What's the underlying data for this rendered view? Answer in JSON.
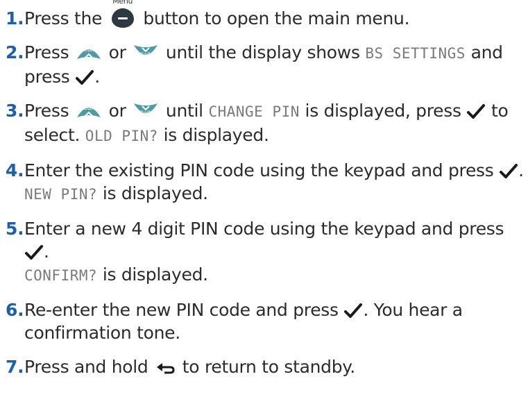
{
  "steps": [
    {
      "number": "1",
      "parts": {
        "a": "Press the",
        "menu_caption": "Menu",
        "b": "button to open the main menu."
      }
    },
    {
      "number": "2",
      "parts": {
        "a": "Press",
        "redial_label": "Redial",
        "or": "or",
        "calls_label": "Calls",
        "b": "until the display shows",
        "lcd": "BS SETTINGS",
        "c": "and",
        "d": "press",
        "e": "."
      }
    },
    {
      "number": "3",
      "parts": {
        "a": "Press",
        "redial_label": "Redial",
        "or": "or",
        "calls_label": "Calls",
        "b": "until",
        "lcd": "CHANGE PIN",
        "c": "is displayed, press",
        "d": "to",
        "e": "select.",
        "lcd2": "OLD PIN?",
        "f": "is displayed."
      }
    },
    {
      "number": "4",
      "parts": {
        "a": "Enter the existing PIN code using the keypad and press",
        "b": ".",
        "lcd": "NEW PIN?",
        "c": "is displayed."
      }
    },
    {
      "number": "5",
      "parts": {
        "a": "Enter a new 4 digit PIN code using the keypad and press",
        "b": ".",
        "lcd": "CONFIRM?",
        "c": "is displayed."
      }
    },
    {
      "number": "6",
      "parts": {
        "a": "Re-enter the new PIN code and press",
        "b": ". You hear a",
        "c": "confirmation tone."
      }
    },
    {
      "number": "7",
      "parts": {
        "a": "Press and hold",
        "b": "to return to standby."
      }
    }
  ],
  "colors": {
    "number": "#1f5fa8",
    "button_dark": "#2e3842",
    "button_teal": "#4f9aa3",
    "lcd_text": "#7a7a7a"
  },
  "icons": [
    "menu-button-icon",
    "redial-up-button-icon",
    "calls-down-button-icon",
    "ok-tick-icon",
    "back-arrow-icon"
  ]
}
